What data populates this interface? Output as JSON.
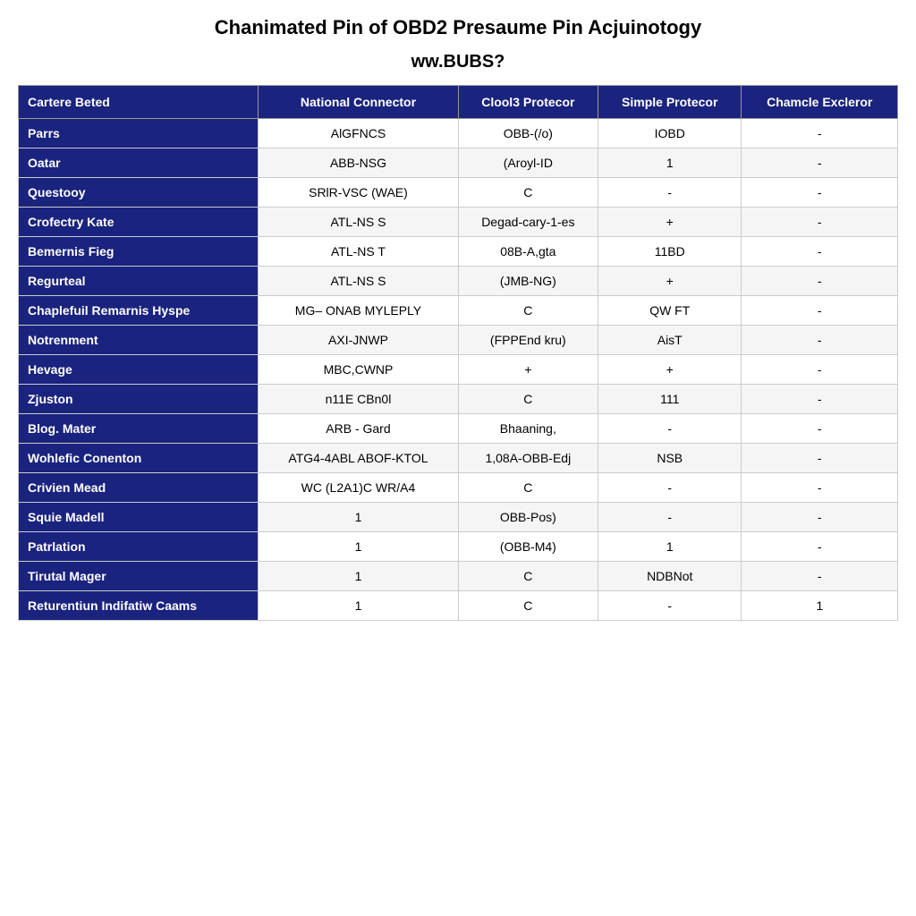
{
  "page": {
    "title": "Chanimated Pin of OBD2 Presaume Pin Acjuinotogy",
    "subtitle": "ww.BUBS?",
    "table": {
      "headers": [
        "Cartere Beted",
        "National Connector",
        "Clool3 Protecor",
        "Simple Protecor",
        "Chamcle Excleror"
      ],
      "rows": [
        {
          "col1": "Parrs",
          "col2": "AlGFNCS",
          "col3": "OBB-(/o)",
          "col4": "IOBD",
          "col5": "-"
        },
        {
          "col1": "Oatar",
          "col2": "ABB-NSG",
          "col3": "(Aroyl-ID",
          "col4": "1",
          "col5": "-"
        },
        {
          "col1": "Questooy",
          "col2": "SRlR-VSC (WAE)",
          "col3": "C",
          "col4": "-",
          "col5": "-"
        },
        {
          "col1": "Crofectry Kate",
          "col2": "ATL-NS S",
          "col3": "Degad-cary-1-es",
          "col4": "+",
          "col5": "-"
        },
        {
          "col1": "Bemernis Fieg",
          "col2": "ATL-NS T",
          "col3": "08B-A,gta",
          "col4": "11BD",
          "col5": "-"
        },
        {
          "col1": "Regurteal",
          "col2": "ATL-NS S",
          "col3": "(JMB-NG)",
          "col4": "+",
          "col5": "-"
        },
        {
          "col1": "Chaplefuil Remarnis Hyspe",
          "col2": "MG– ONAB MYLEPLY",
          "col3": "C",
          "col4": "QW FT",
          "col5": "-"
        },
        {
          "col1": "Notrenment",
          "col2": "AXI-JNWP",
          "col3": "(FPPEnd kru)",
          "col4": "AisT",
          "col5": "-"
        },
        {
          "col1": "Hevage",
          "col2": "MBC,CWNP",
          "col3": "+",
          "col4": "+",
          "col5": "-"
        },
        {
          "col1": "Zjuston",
          "col2": "n11E CBn0l",
          "col3": "C",
          "col4": "111",
          "col5": "-"
        },
        {
          "col1": "Blog. Mater",
          "col2": "ARB - Gard",
          "col3": "Bhaaning,",
          "col4": "-",
          "col5": "-"
        },
        {
          "col1": "Wohlefic Conenton",
          "col2": "ATG4-4ABL ABOF-KTOL",
          "col3": "1,08A-OBB-Edj",
          "col4": "NSB",
          "col5": "-"
        },
        {
          "col1": "Crivien Mead",
          "col2": "WC (L2A1)C WR/A4",
          "col3": "C",
          "col4": "-",
          "col5": "-"
        },
        {
          "col1": "Squie Madell",
          "col2": "1",
          "col3": "OBB-Pos)",
          "col4": "-",
          "col5": "-"
        },
        {
          "col1": "Patrlation",
          "col2": "1",
          "col3": "(OBB-M4)",
          "col4": "1",
          "col5": "-"
        },
        {
          "col1": "Tirutal Mager",
          "col2": "1",
          "col3": "C",
          "col4": "NDBNot",
          "col5": "-"
        },
        {
          "col1": "Returentiun Indifatiw Caams",
          "col2": "1",
          "col3": "C",
          "col4": "-",
          "col5": "1"
        }
      ]
    }
  }
}
